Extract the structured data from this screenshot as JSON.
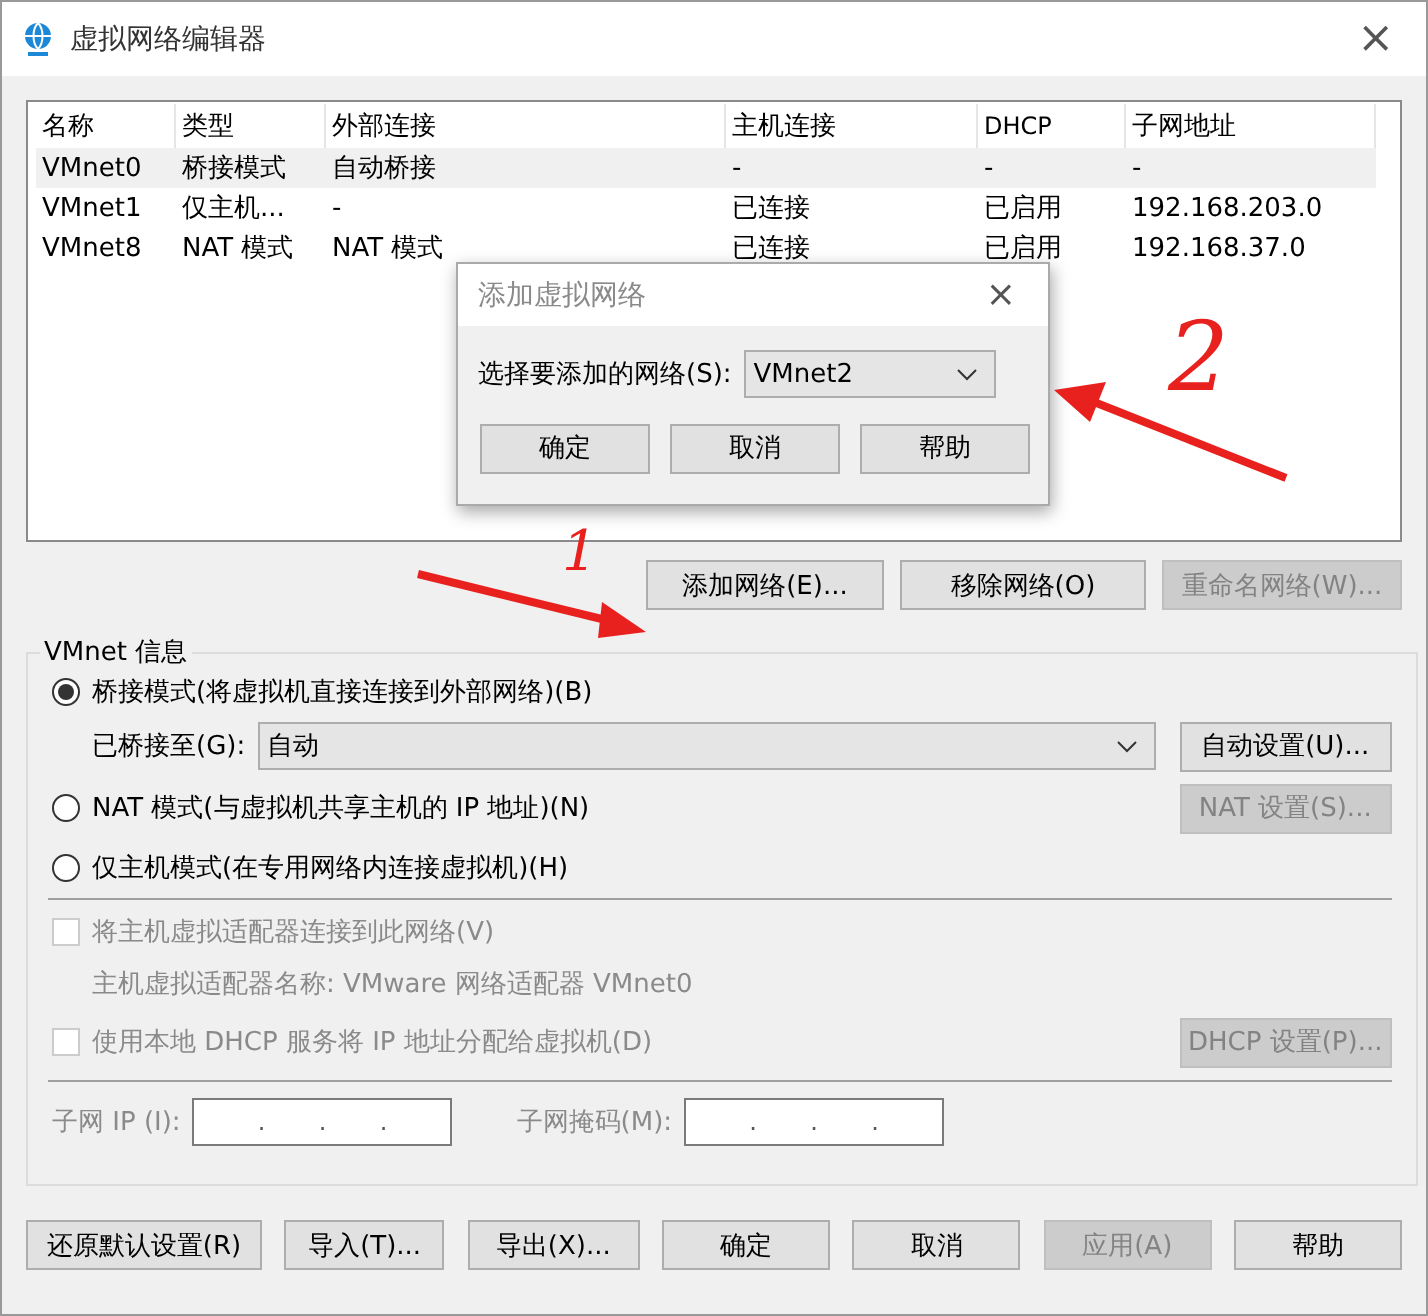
{
  "window": {
    "title": "虚拟网络编辑器",
    "close": "×"
  },
  "table": {
    "columns": [
      "名称",
      "类型",
      "外部连接",
      "主机连接",
      "DHCP",
      "子网地址"
    ],
    "rows": [
      {
        "selected": true,
        "cells": [
          "VMnet0",
          "桥接模式",
          "自动桥接",
          "-",
          "-",
          "-"
        ]
      },
      {
        "selected": false,
        "cells": [
          "VMnet1",
          "仅主机...",
          "-",
          "已连接",
          "已启用",
          "192.168.203.0"
        ]
      },
      {
        "selected": false,
        "cells": [
          "VMnet8",
          "NAT 模式",
          "NAT 模式",
          "已连接",
          "已启用",
          "192.168.37.0"
        ]
      }
    ]
  },
  "network_buttons": [
    {
      "label": "添加网络(E)...",
      "disabled": false
    },
    {
      "label": "移除网络(O)",
      "disabled": false
    },
    {
      "label": "重命名网络(W)...",
      "disabled": true
    }
  ],
  "vmnet_info": {
    "title": "VMnet 信息",
    "modes": [
      {
        "label": "桥接模式(将虚拟机直接连接到外部网络)(B)",
        "selected": true
      },
      {
        "label": "NAT 模式(与虚拟机共享主机的 IP 地址)(N)",
        "selected": false
      },
      {
        "label": "仅主机模式(在专用网络内连接虚拟机)(H)",
        "selected": false
      }
    ],
    "bridged_to": {
      "label": "已桥接至(G):",
      "value": "自动",
      "button": "自动设置(U)..."
    },
    "nat_button": {
      "label": "NAT 设置(S)...",
      "disabled": true
    },
    "host_adapter": {
      "label": "将主机虚拟适配器连接到此网络(V)",
      "checked": false,
      "disabled": true,
      "note": "主机虚拟适配器名称: VMware 网络适配器 VMnet0"
    },
    "dhcp": {
      "label": "使用本地 DHCP 服务将 IP 地址分配给虚拟机(D)",
      "checked": false,
      "disabled": true,
      "button": "DHCP 设置(P)..."
    },
    "subnet_ip": {
      "label": "子网 IP (I):",
      "value": ".       .       ."
    },
    "subnet_mask": {
      "label": "子网掩码(M):",
      "value": ".       .       ."
    }
  },
  "footer_buttons": [
    {
      "label": "还原默认设置(R)",
      "disabled": false
    },
    {
      "label": "导入(T)...",
      "disabled": false
    },
    {
      "label": "导出(X)...",
      "disabled": false
    },
    {
      "label": "确定",
      "disabled": false
    },
    {
      "label": "取消",
      "disabled": false
    },
    {
      "label": "应用(A)",
      "disabled": true
    },
    {
      "label": "帮助",
      "disabled": false
    }
  ],
  "dialog": {
    "title": "添加虚拟网络",
    "close": "×",
    "label": "选择要添加的网络(S):",
    "value": "VMnet2",
    "buttons": [
      "确定",
      "取消",
      "帮助"
    ]
  },
  "annotations": [
    "1",
    "2"
  ]
}
